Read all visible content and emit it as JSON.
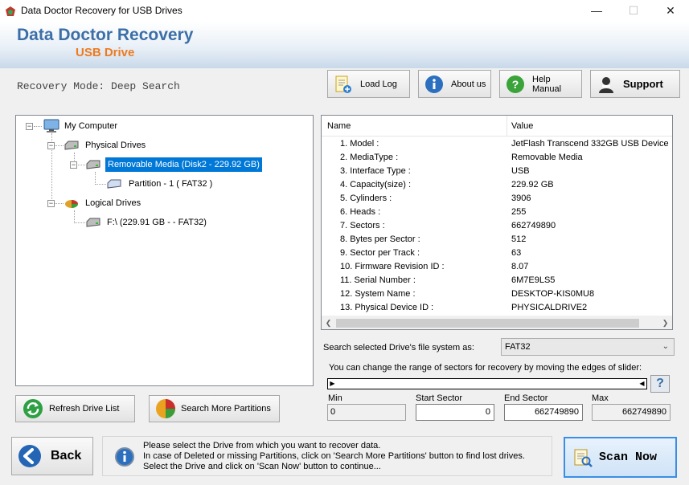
{
  "window": {
    "title": "Data Doctor Recovery for USB Drives",
    "minimize": "—",
    "maximize": "☐",
    "close": "✕"
  },
  "banner": {
    "brand": "Data Doctor Recovery",
    "subtitle": "USB Drive"
  },
  "mode_text": "Recovery Mode: Deep Search",
  "header_buttons": {
    "load_log": "Load Log",
    "about_us": "About us",
    "help_manual": "Help Manual",
    "support": "Support"
  },
  "tree": {
    "root": "My Computer",
    "physical": "Physical Drives",
    "removable": "Removable Media (Disk2 - 229.92 GB)",
    "partition": "Partition - 1 ( FAT32 )",
    "logical": "Logical Drives",
    "drive_f": "F:\\ (229.91 GB -  - FAT32)"
  },
  "props": {
    "col_name": "Name",
    "col_value": "Value",
    "rows": [
      {
        "name": "1. Model :",
        "value": "JetFlash Transcend 332GB USB Device"
      },
      {
        "name": "2. MediaType :",
        "value": "Removable Media"
      },
      {
        "name": "3. Interface Type :",
        "value": "USB"
      },
      {
        "name": "4. Capacity(size) :",
        "value": "229.92 GB"
      },
      {
        "name": "5. Cylinders :",
        "value": "3906"
      },
      {
        "name": "6. Heads :",
        "value": "255"
      },
      {
        "name": "7. Sectors :",
        "value": "662749890"
      },
      {
        "name": "8. Bytes per Sector :",
        "value": "512"
      },
      {
        "name": "9. Sector per Track :",
        "value": "63"
      },
      {
        "name": "10. Firmware Revision ID :",
        "value": "8.07"
      },
      {
        "name": "11. Serial Number :",
        "value": "6M7E9LS5"
      },
      {
        "name": "12. System Name :",
        "value": "DESKTOP-KIS0MU8"
      },
      {
        "name": "13. Physical Device ID :",
        "value": "PHYSICALDRIVE2"
      }
    ]
  },
  "fs": {
    "label": "Search selected Drive's file system as:",
    "selected": "FAT32"
  },
  "slider": {
    "help_text": "You can change the range of sectors for recovery by moving the edges of slider:",
    "help_button": "?",
    "min_label": "Min",
    "min_value": "0",
    "start_label": "Start Sector",
    "start_value": "0",
    "end_label": "End Sector",
    "end_value": "662749890",
    "max_label": "Max",
    "max_value": "662749890"
  },
  "buttons": {
    "refresh": "Refresh Drive List",
    "search_more": "Search More Partitions",
    "back": "Back",
    "scan_now": "Scan Now"
  },
  "info": {
    "line1": "Please select the Drive from which you want to recover data.",
    "line2": "In case of Deleted or missing Partitions, click on 'Search More Partitions' button to find lost drives.",
    "line3": "Select the Drive and click on 'Scan Now' button to continue..."
  },
  "icons": [
    "app-icon",
    "log-icon",
    "info-icon",
    "help-icon",
    "support-icon",
    "computer-icon",
    "drive-icon",
    "partition-icon",
    "pie-icon",
    "refresh-icon",
    "back-arrow-icon",
    "scan-icon"
  ],
  "colors": {
    "brand": "#3c6fa7",
    "accent": "#ee7a1f",
    "selection": "#0078d7"
  }
}
